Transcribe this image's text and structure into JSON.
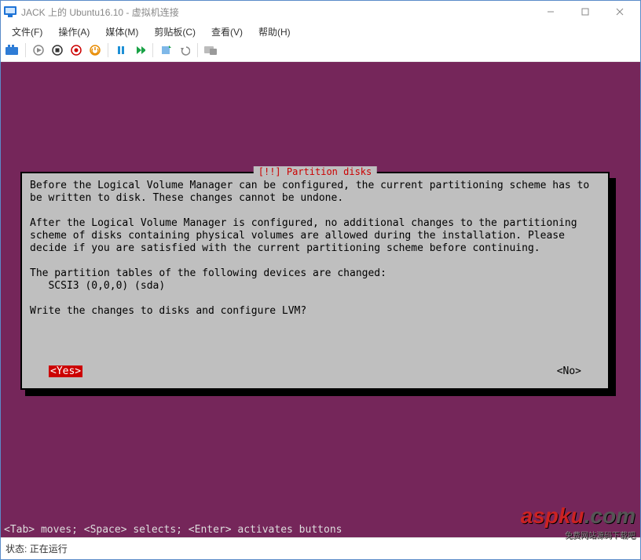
{
  "window": {
    "title": "JACK 上的 Ubuntu16.10 - 虚拟机连接"
  },
  "menu": {
    "file": "文件(F)",
    "action": "操作(A)",
    "media": "媒体(M)",
    "clipboard": "剪贴板(C)",
    "view": "查看(V)",
    "help": "帮助(H)"
  },
  "dialog": {
    "title": "[!!] Partition disks",
    "para1": "Before the Logical Volume Manager can be configured, the current partitioning scheme has to be written to disk. These changes cannot be undone.",
    "para2": "After the Logical Volume Manager is configured, no additional changes to the partitioning scheme of disks containing physical volumes are allowed during the installation. Please decide if you are satisfied with the current partitioning scheme before continuing.",
    "para3": "The partition tables of the following devices are changed:",
    "device": "   SCSI3 (0,0,0) (sda)",
    "question": "Write the changes to disks and configure LVM?",
    "yes": "<Yes>",
    "no": "<No>"
  },
  "hints": "<Tab> moves; <Space> selects; <Enter> activates buttons",
  "statusbar": {
    "label": "状态:",
    "value": "正在运行"
  },
  "watermark": {
    "site": "aspku",
    "tld": ".com",
    "slogan": "免费网站源码下载吧"
  }
}
